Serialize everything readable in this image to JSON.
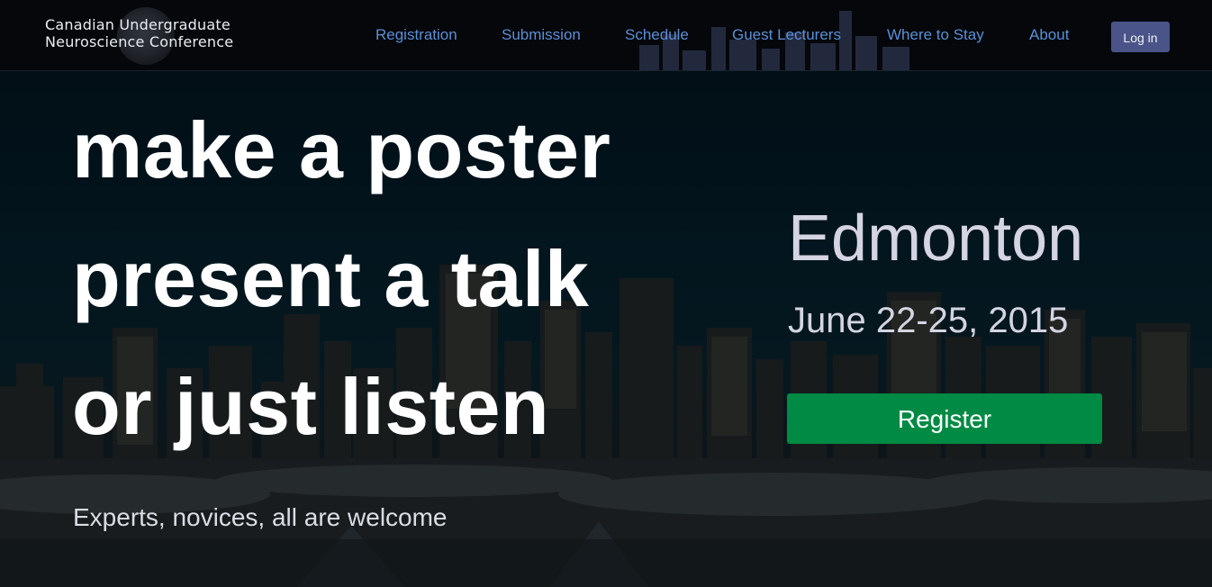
{
  "brand": {
    "line1": "Canadian Undergraduate",
    "line2": "Neuroscience Conference",
    "emblem_icon": "brain-emblem-icon"
  },
  "nav": {
    "links": [
      "Registration",
      "Submission",
      "Schedule",
      "Guest Lecturers",
      "Where to Stay",
      "About"
    ],
    "login_label": "Log in"
  },
  "hero": {
    "headline": [
      "make a poster",
      "present a talk",
      "or just listen"
    ],
    "tagline": "Experts, novices, all are welcome",
    "city": "Edmonton",
    "dates": "June 22-25, 2015",
    "register_label": "Register",
    "background": "edmonton-skyline-winter-photo"
  },
  "colors": {
    "nav_background": "#05070b",
    "nav_link": "#5b8fd6",
    "login_button": "#4a5488",
    "register_button": "#008a43",
    "headline_text": "#ffffff",
    "event_text": "#d4d4e2"
  }
}
